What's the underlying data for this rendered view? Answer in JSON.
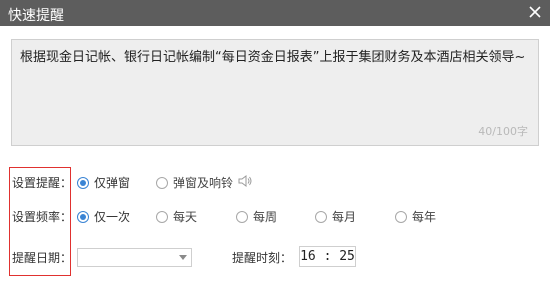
{
  "window": {
    "title": "快速提醒"
  },
  "message": {
    "text": "根据现金日记帐、银行日记帐编制“每日资金日报表”上报于集团财务及本酒店相关领导~",
    "char_count": "40/100字"
  },
  "reminder_type": {
    "label": "设置提醒：",
    "options": [
      {
        "label": "仅弹窗",
        "selected": true
      },
      {
        "label": "弹窗及响铃",
        "selected": false
      }
    ],
    "speaker_icon": "speaker-icon"
  },
  "frequency": {
    "label": "设置频率：",
    "options": [
      {
        "label": "仅一次",
        "selected": true
      },
      {
        "label": "每天",
        "selected": false
      },
      {
        "label": "每周",
        "selected": false
      },
      {
        "label": "每月",
        "selected": false
      },
      {
        "label": "每年",
        "selected": false
      }
    ]
  },
  "date": {
    "label": "提醒日期：",
    "value": ""
  },
  "time": {
    "label": "提醒时刻：",
    "value": "16 : 25"
  },
  "colors": {
    "titlebar": "#5d5d5d",
    "accent": "#3a84d4",
    "highlight_border": "#e0312f"
  }
}
